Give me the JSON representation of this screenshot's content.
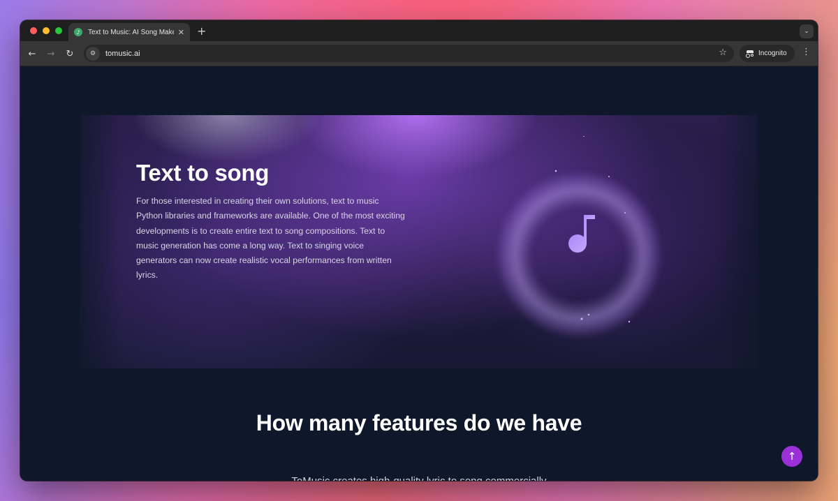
{
  "browser": {
    "tab_title": "Text to Music: AI Song Maker",
    "tab_close": "✕",
    "new_tab": "+",
    "url": "tomusic.ai",
    "incognito_label": "Incognito",
    "menu_icon": "⋮",
    "back_icon": "←",
    "forward_icon": "→",
    "reload_icon": "↻",
    "star_icon": "☆",
    "tab_search_icon": "⌄"
  },
  "hero": {
    "title": "Text to song",
    "body": "For those interested in creating their own solutions, text to music Python libraries and frameworks are available. One of the most exciting developments is to create entire text to song compositions. Text to music generation has come a long way. Text to singing voice generators can now create realistic vocal performances from written lyrics."
  },
  "features": {
    "title": "How many features do we have",
    "subtitle": "ToMusic creates high-quality lyric to song commercially"
  },
  "scroll_top_icon": "↑",
  "colors": {
    "page_bg": "#0f172a",
    "accent": "#9b30d9",
    "note": "#a98cf5"
  }
}
